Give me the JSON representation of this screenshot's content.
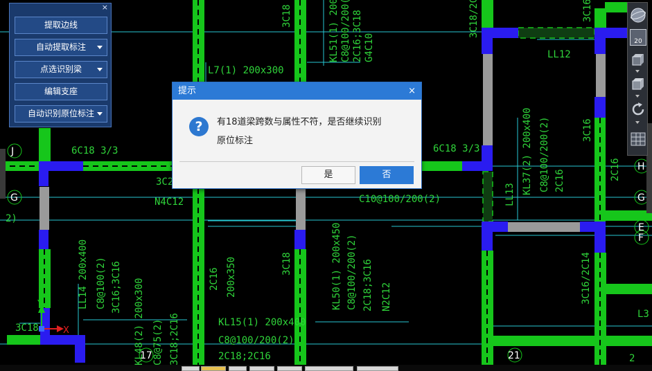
{
  "tool_panel": {
    "close": "×",
    "buttons": [
      {
        "label": "提取边线",
        "dropdown": false
      },
      {
        "label": "自动提取标注",
        "dropdown": true
      },
      {
        "label": "点选识别梁",
        "dropdown": true
      },
      {
        "label": "编辑支座",
        "dropdown": false
      },
      {
        "label": "自动识别原位标注",
        "dropdown": true
      }
    ]
  },
  "view_toolbar": {
    "zoom_label": "20"
  },
  "dialog": {
    "title": "提示",
    "close": "×",
    "icon": "?",
    "message_line1": "有18道梁跨数与属性不符，是否继续识别",
    "message_line2": "原位标注",
    "yes": "是",
    "no": "否"
  },
  "drawing": {
    "annotations": [
      "L7(1) 200x300",
      "KL51(1) 200x600",
      "C8@100/200(2)",
      "2C16;3C18",
      "G4C10",
      "3C18",
      "3C18/2C",
      "LL12",
      "3C16",
      "6C18 3/3",
      "3C2",
      "N4C12",
      "C10@100/200(2)",
      "6C18 3/3",
      "LL13",
      "KL37(2) 200x400",
      "C8@100/200(2)",
      "2C16",
      "3C16",
      "2C16",
      "KL50(1) 200x450",
      "C8@100/200(2)",
      "2C18;3C16",
      "N2C12",
      "200x350",
      "2C16",
      "3C18",
      "LL14 200x400",
      "C8@100(2)",
      "3C16;3C16",
      "KL15(1) 200x400",
      "C8@100/200(2)",
      "2C18;2C16",
      "KL48(2) 200x300",
      "C8@75(2)",
      "3C18;2C16",
      "3C16/2C14",
      "3C18",
      "L3",
      "2"
    ],
    "axis_labels": [
      "J",
      "G",
      "H",
      "G",
      "E",
      "F",
      "17",
      "21",
      "2)"
    ],
    "ucs": {
      "x": "X",
      "y": "Y"
    }
  }
}
